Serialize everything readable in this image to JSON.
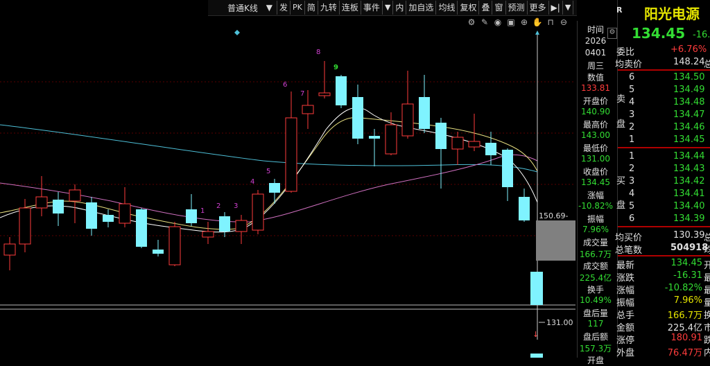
{
  "toolbar": {
    "period": "普通K线",
    "buttons": [
      "发",
      "PK",
      "简",
      "九转",
      "连板",
      "事件",
      "▼",
      "内",
      "加自选",
      "均线",
      "复权",
      "叠",
      "窗",
      "预测",
      "更多"
    ]
  },
  "chart": {
    "price_label_top": "150.69-",
    "price_label_low": "131.00",
    "low_marker": "↓",
    "td_labels": {
      "s1": "1",
      "s2": "2",
      "s3": "3",
      "s4": "4",
      "s5": "5",
      "s6": "6",
      "s7": "7",
      "s8": "8",
      "s9": "9"
    }
  },
  "info": {
    "time_label": "时间",
    "year": "2026",
    "date": "0401",
    "weekday": "周三",
    "value_label": "数值",
    "value": "133.81",
    "open_label": "开盘价",
    "open": "140.90",
    "high_label": "最高价",
    "high": "143.00",
    "low_label": "最低价",
    "low": "131.00",
    "close_label": "收盘价",
    "close": "134.45",
    "change_pct_label": "涨幅",
    "change_pct": "-10.82%",
    "amplitude_label": "振幅",
    "amplitude": "7.96%",
    "volume_label": "成交量",
    "volume": "166.7万",
    "turnover_label": "成交额",
    "turnover": "225.4亿",
    "hand_label": "换手",
    "hand": "10.49%",
    "after_vol_label": "盘后量",
    "after_vol": "117",
    "after_amt_label": "盘后额",
    "after_amt": "157.3万",
    "cut_label": "开盘"
  },
  "panel": {
    "flag": "R",
    "stock_name": "阳光电源",
    "price": "134.45",
    "price_change": "-16.",
    "weibi_label": "委比",
    "weibi": "+6.76%",
    "avg_sell_label": "均卖价",
    "avg_sell": "148.24",
    "avg_sell_tail": "总",
    "sell_label": [
      "卖",
      "盘"
    ],
    "asks": [
      {
        "level": "6",
        "price": "134.50"
      },
      {
        "level": "5",
        "price": "134.49"
      },
      {
        "level": "4",
        "price": "134.48"
      },
      {
        "level": "3",
        "price": "134.47"
      },
      {
        "level": "2",
        "price": "134.46"
      },
      {
        "level": "1",
        "price": "134.45"
      }
    ],
    "buy_label": [
      "买",
      "盘"
    ],
    "bids": [
      {
        "level": "1",
        "price": "134.44"
      },
      {
        "level": "2",
        "price": "134.43"
      },
      {
        "level": "3",
        "price": "134.42"
      },
      {
        "level": "4",
        "price": "134.41"
      },
      {
        "level": "5",
        "price": "134.40"
      },
      {
        "level": "6",
        "price": "134.39"
      }
    ],
    "avg_buy_label": "均买价",
    "avg_buy": "130.39",
    "avg_buy_tail": "总",
    "total_orders_label": "总笔数",
    "total_orders": "504918",
    "total_orders_tail": "均",
    "stats": [
      {
        "label": "最新",
        "value": "134.45",
        "tail": "开",
        "color": "green"
      },
      {
        "label": "涨跌",
        "value": "-16.31",
        "tail": "最",
        "color": "green"
      },
      {
        "label": "涨幅",
        "value": "-10.82%",
        "tail": "最",
        "color": "green"
      },
      {
        "label": "振幅",
        "value": "7.96%",
        "tail": "量",
        "color": "yellow"
      },
      {
        "label": "总手",
        "value": "166.7万",
        "tail": "换",
        "color": "yellow"
      },
      {
        "label": "金额",
        "value": "225.4亿",
        "tail": "市",
        "color": "white"
      },
      {
        "label": "涨停",
        "value": "180.91",
        "tail": "跌",
        "color": "red"
      },
      {
        "label": "外盘",
        "value": "76.47万",
        "tail": "内",
        "color": "red"
      }
    ]
  }
}
